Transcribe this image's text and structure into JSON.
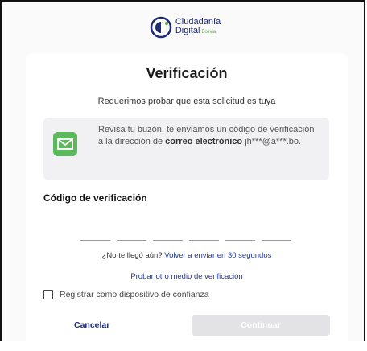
{
  "brand": {
    "line1": "Ciudadanía",
    "line2": "Digital",
    "country": "Bolivia"
  },
  "page": {
    "title": "Verificación",
    "subtitle": "Requerimos probar que esta solicitud es tuya"
  },
  "info": {
    "icon": "mail-icon",
    "text_before": "Revisa tu buzón, te enviamos un código de verificación a la dirección de",
    "text_bold": "correo electrónico",
    "email": "jh***@a***.bo."
  },
  "code": {
    "label": "Código de verificación",
    "digits": [
      "",
      "",
      "",
      "",
      "",
      ""
    ]
  },
  "resend": {
    "question": "¿No te llegó aún?",
    "link": "Volver a enviar en 30 segundos"
  },
  "other_method": "Probar otro medio de verificación",
  "trust_device": {
    "label": "Registrar como dispositivo de confianza",
    "checked": false
  },
  "actions": {
    "cancel": "Cancelar",
    "continue": "Continuar"
  }
}
